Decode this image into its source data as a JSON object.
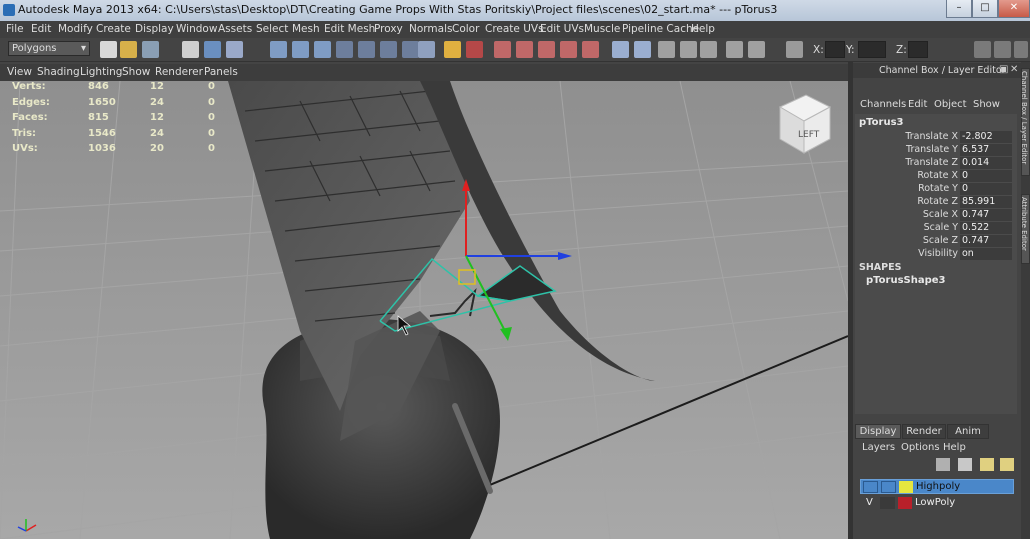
{
  "window": {
    "title": "Autodesk Maya 2013 x64: C:\\Users\\stas\\Desktop\\DT\\Creating Game Props With Stas Poritskiy\\Project files\\scenes\\02_start.ma*   ---   pTorus3"
  },
  "menubar": {
    "items": [
      "File",
      "Edit",
      "Modify",
      "Create",
      "Display",
      "Window",
      "Assets",
      "Select",
      "Mesh",
      "Edit Mesh",
      "Proxy",
      "Normals",
      "Color",
      "Create UVs",
      "Edit UVs",
      "Muscle",
      "Pipeline Cache",
      "Help"
    ]
  },
  "statusline": {
    "mode": "Polygons",
    "coord_labels": [
      "X:",
      "Y:",
      "Z:"
    ]
  },
  "viewport_menu": {
    "items": [
      "View",
      "Shading",
      "Lighting",
      "Show",
      "Renderer",
      "Panels"
    ]
  },
  "hud": {
    "rows": [
      {
        "label": "Verts:",
        "a": "846",
        "b": "12",
        "c": "0"
      },
      {
        "label": "Edges:",
        "a": "1650",
        "b": "24",
        "c": "0"
      },
      {
        "label": "Faces:",
        "a": "815",
        "b": "12",
        "c": "0"
      },
      {
        "label": "Tris:",
        "a": "1546",
        "b": "24",
        "c": "0"
      },
      {
        "label": "UVs:",
        "a": "1036",
        "b": "20",
        "c": "0"
      }
    ]
  },
  "viewcube": {
    "label": "LEFT"
  },
  "channel_box": {
    "header": "Channel Box / Layer Editor",
    "menu": [
      "Channels",
      "Edit",
      "Object",
      "Show"
    ],
    "object_name": "pTorus3",
    "attributes": [
      {
        "label": "Translate X",
        "value": "-2.802"
      },
      {
        "label": "Translate Y",
        "value": "6.537"
      },
      {
        "label": "Translate Z",
        "value": "0.014"
      },
      {
        "label": "Rotate X",
        "value": "0"
      },
      {
        "label": "Rotate Y",
        "value": "0"
      },
      {
        "label": "Rotate Z",
        "value": "85.991"
      },
      {
        "label": "Scale X",
        "value": "0.747"
      },
      {
        "label": "Scale Y",
        "value": "0.522"
      },
      {
        "label": "Scale Z",
        "value": "0.747"
      },
      {
        "label": "Visibility",
        "value": "on"
      }
    ],
    "shapes_header": "SHAPES",
    "shape_name": "pTorusShape3"
  },
  "layer_editor": {
    "tabs": [
      "Display",
      "Render",
      "Anim"
    ],
    "menu": [
      "Layers",
      "Options",
      "Help"
    ],
    "layers": [
      {
        "name": "Highpoly",
        "visible": "",
        "color": "#e6e640",
        "selected": true
      },
      {
        "name": "LowPoly",
        "visible": "V",
        "color": "#b8202a",
        "selected": false
      }
    ]
  },
  "side_tabs": [
    "Channel Box / Layer Editor",
    "Attribute Editor"
  ],
  "colors": {
    "selection_highlight": "#4a87c9",
    "viewport_bg": "#9d9d9d",
    "manip_x": "#2040e0",
    "manip_y": "#e02020",
    "manip_z": "#20c020"
  }
}
